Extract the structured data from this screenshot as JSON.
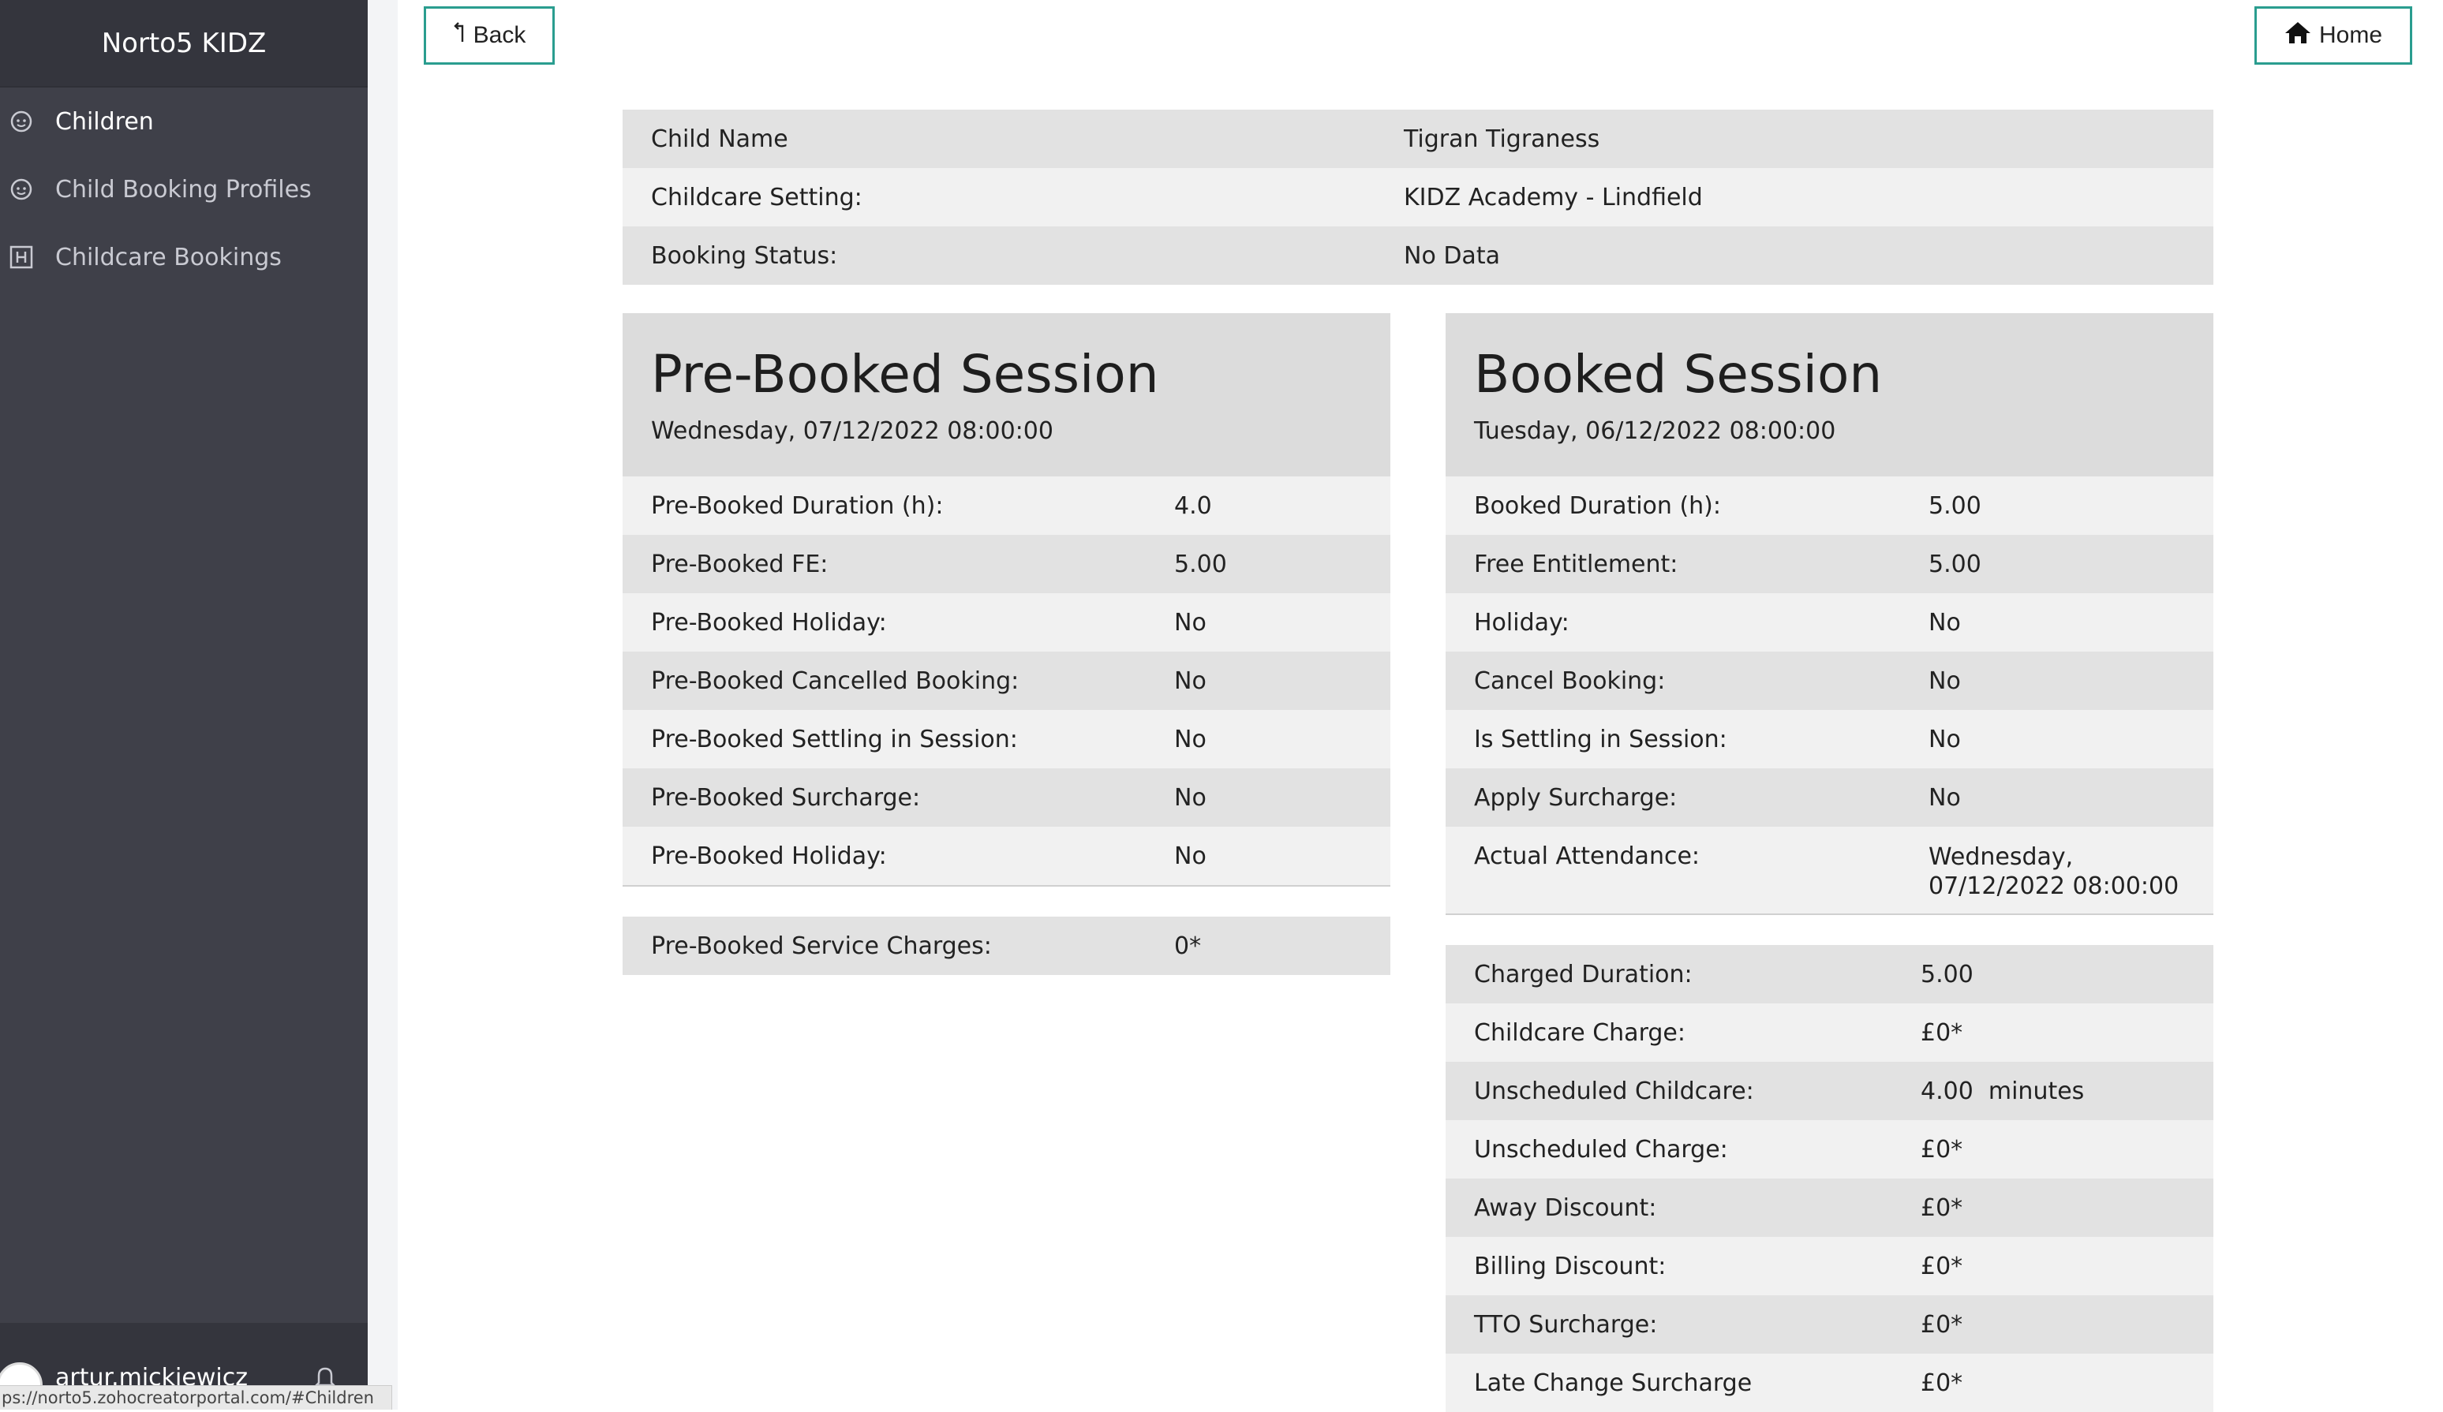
{
  "app": {
    "title": "Norto5 KIDZ"
  },
  "sidebar": {
    "items": [
      {
        "label": "Children",
        "icon": "child-icon"
      },
      {
        "label": "Child Booking Profiles",
        "icon": "child-icon"
      },
      {
        "label": "Childcare Bookings",
        "icon": "booking-icon"
      }
    ],
    "user": "artur.mickiewicz"
  },
  "statusbar": {
    "url": "ps://norto5.zohocreatorportal.com/#Children"
  },
  "toolbar": {
    "back_label": "Back",
    "home_label": "Home"
  },
  "info": [
    {
      "key": "Child Name",
      "value": "Tigran Tigraness"
    },
    {
      "key": "Childcare Setting:",
      "value": "KIDZ Academy - Lindfield"
    },
    {
      "key": "Booking Status:",
      "value": "No Data"
    }
  ],
  "prebooked": {
    "title": "Pre-Booked Session",
    "date": "Wednesday, 07/12/2022 08:00:00",
    "rows": [
      {
        "key": "Pre-Booked Duration (h):",
        "value": "4.0"
      },
      {
        "key": "Pre-Booked FE:",
        "value": "5.00"
      },
      {
        "key": "Pre-Booked Holiday:",
        "value": "No"
      },
      {
        "key": "Pre-Booked Cancelled Booking:",
        "value": "No"
      },
      {
        "key": "Pre-Booked Settling in Session:",
        "value": "No"
      },
      {
        "key": "Pre-Booked Surcharge:",
        "value": "No"
      },
      {
        "key": "Pre-Booked Holiday:",
        "value": "No"
      }
    ],
    "charges": [
      {
        "key": "Pre-Booked Service Charges:",
        "value": "0*"
      }
    ]
  },
  "booked": {
    "title": "Booked Session",
    "date": "Tuesday, 06/12/2022 08:00:00",
    "rows": [
      {
        "key": "Booked Duration (h):",
        "value": "5.00"
      },
      {
        "key": "Free Entitlement:",
        "value": "5.00"
      },
      {
        "key": "Holiday:",
        "value": "No"
      },
      {
        "key": "Cancel Booking:",
        "value": "No"
      },
      {
        "key": "Is Settling in Session:",
        "value": "No"
      },
      {
        "key": "Apply Surcharge:",
        "value": "No"
      },
      {
        "key": "Actual Attendance:",
        "value": "Wednesday, 07/12/2022 08:00:00"
      }
    ],
    "charges": [
      {
        "key": "Charged Duration:",
        "value": "5.00"
      },
      {
        "key": "Childcare Charge:",
        "value": "£0*"
      },
      {
        "key": "Unscheduled Childcare:",
        "value": "4.00  minutes"
      },
      {
        "key": "Unscheduled Charge:",
        "value": "£0*"
      },
      {
        "key": "Away Discount:",
        "value": "£0*"
      },
      {
        "key": "Billing Discount:",
        "value": "£0*"
      },
      {
        "key": "TTO Surcharge:",
        "value": "£0*"
      },
      {
        "key": "Late Change Surcharge",
        "value": "£0*"
      }
    ]
  },
  "colors": {
    "accent": "#2a9d8f",
    "sidebar": "#3f4049",
    "row_dark": "#e2e2e2",
    "row_light": "#f1f1f1"
  }
}
